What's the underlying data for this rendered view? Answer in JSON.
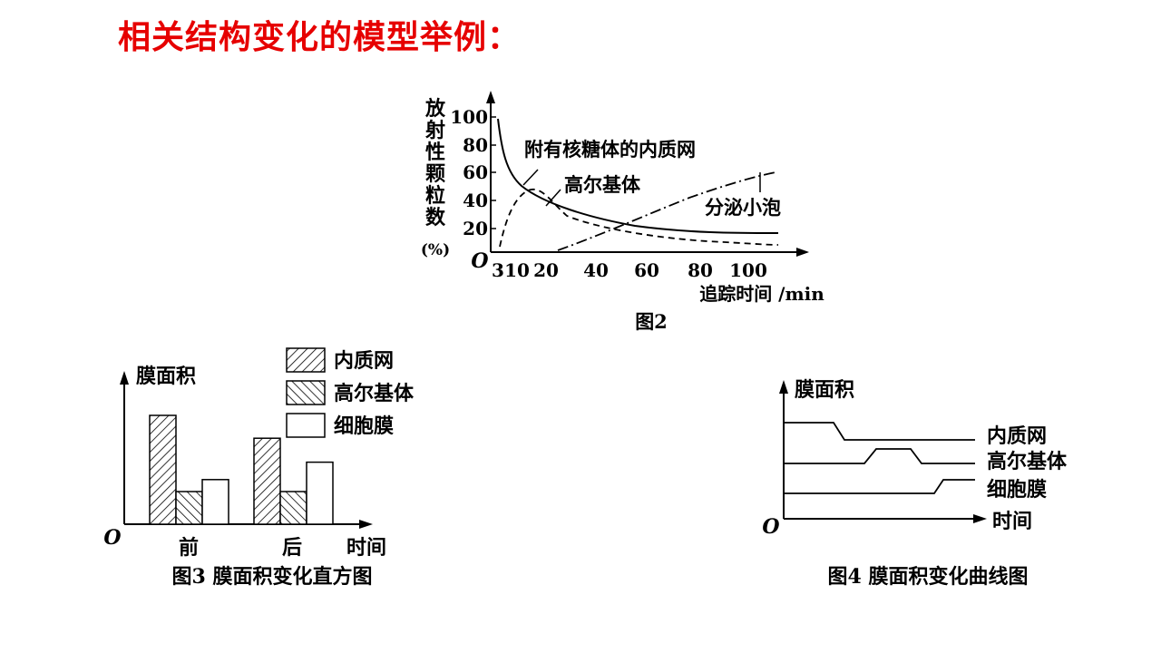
{
  "title": "相关结构变化的模型举例：",
  "accent_color": "#e60000",
  "fig2": {
    "caption": "图2",
    "y_label_chars": [
      "放",
      "射",
      "性",
      "颗",
      "粒",
      "数"
    ],
    "y_unit": "(%)",
    "origin": "O",
    "y_ticks": [
      "100",
      "80",
      "60",
      "40",
      "20"
    ],
    "x_ticks": [
      "3",
      "10",
      "20",
      "40",
      "60",
      "80",
      "100"
    ],
    "x_label": "追踪时间 /min",
    "labels": {
      "er": "附有核糖体的内质网",
      "golgi": "高尔基体",
      "vesicle": "分泌小泡"
    }
  },
  "fig3": {
    "caption": "图3  膜面积变化直方图",
    "y_label": "膜面积",
    "origin": "O",
    "x_label": "时间",
    "groups": [
      "前",
      "后"
    ],
    "legend": [
      "内质网",
      "高尔基体",
      "细胞膜"
    ],
    "chart_data": {
      "type": "bar",
      "categories": [
        "前",
        "后"
      ],
      "series": [
        {
          "name": "内质网",
          "values": [
            100,
            79
          ]
        },
        {
          "name": "高尔基体",
          "values": [
            30,
            30
          ]
        },
        {
          "name": "细胞膜",
          "values": [
            41,
            57
          ]
        }
      ]
    }
  },
  "fig4": {
    "caption": "图4  膜面积变化曲线图",
    "y_label": "膜面积",
    "origin": "O",
    "x_label": "时间",
    "line_labels": [
      "内质网",
      "高尔基体",
      "细胞膜"
    ]
  }
}
